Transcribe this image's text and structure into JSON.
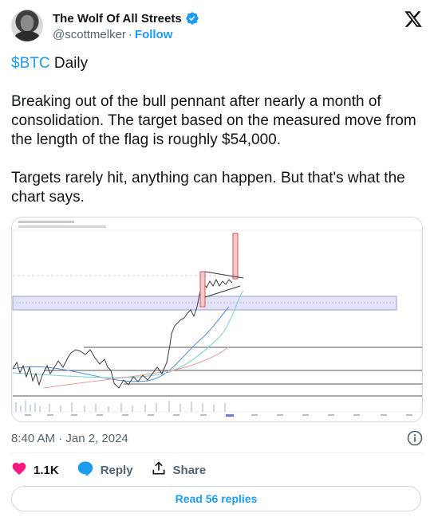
{
  "author": {
    "display_name": "The Wolf Of All Streets",
    "handle": "@scottmelker",
    "separator": "·",
    "follow_label": "Follow"
  },
  "tweet": {
    "cashtag": "$BTC",
    "first_line_rest": " Daily",
    "paragraph_2": "Breaking out of the bull pennant after nearly a month of consolidation. The target based on the measured move from the length of the flag is roughly $54,000.",
    "paragraph_3": "Targets rarely hit, anything can happen. But that's what the chart says."
  },
  "timestamp": "8:40 AM · Jan 2, 2024",
  "actions": {
    "like_count": "1.1K",
    "reply_label": "Reply",
    "share_label": "Share"
  },
  "read_replies_label": "Read 56 replies",
  "colors": {
    "accent": "#1d9bf0",
    "like_red": "#f91880",
    "text_secondary": "#536471"
  },
  "icons": [
    "verified-badge-icon",
    "x-logo-icon",
    "info-icon",
    "heart-icon",
    "reply-icon",
    "share-icon"
  ]
}
